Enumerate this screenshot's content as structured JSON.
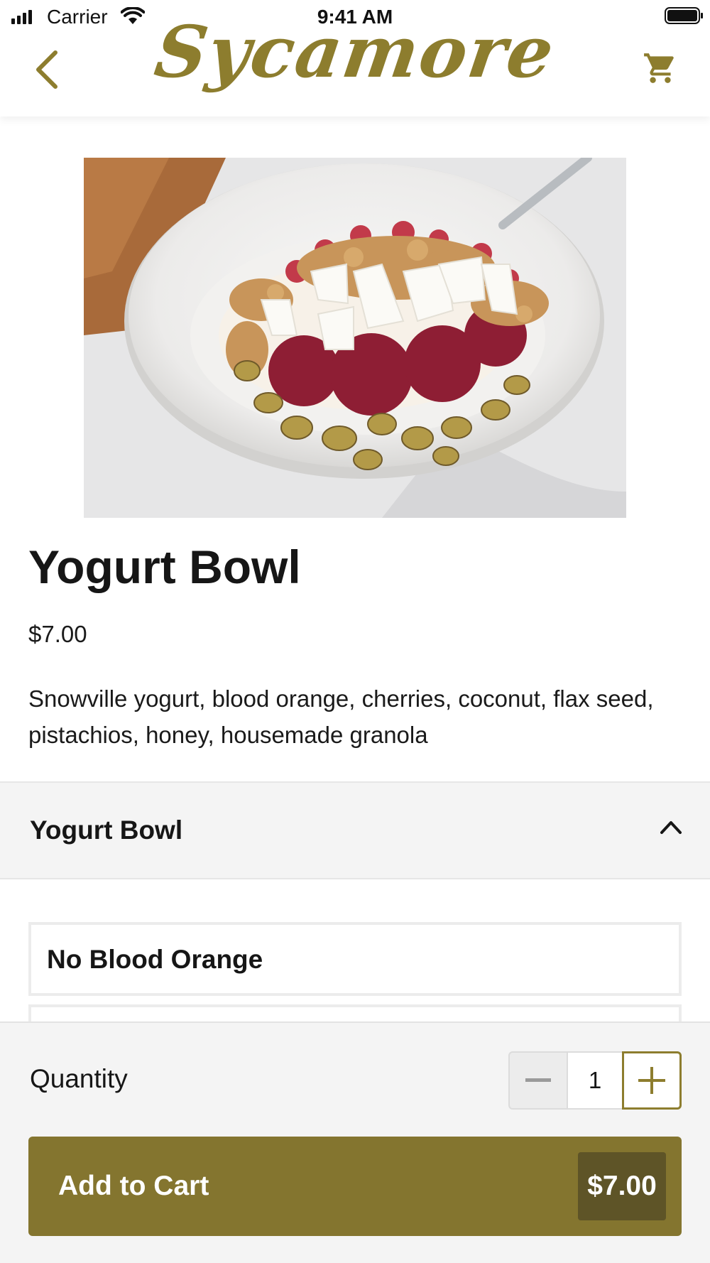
{
  "status_bar": {
    "carrier": "Carrier",
    "time": "9:41 AM",
    "icons": [
      "signal-icon",
      "wifi-icon",
      "battery-icon"
    ]
  },
  "header": {
    "logo_text": "Sycamore",
    "back_icon": "chevron-left-icon",
    "cart_icon": "cart-icon",
    "brand_color": "#8d7d2e"
  },
  "product": {
    "image_description_icon": "yogurt-bowl-photo",
    "title": "Yogurt Bowl",
    "price": "$7.00",
    "description": "Snowville yogurt, blood orange, cherries, coconut, flax seed, pistachios, honey, housemade granola"
  },
  "modifiers": {
    "section_title": "Yogurt Bowl",
    "expanded": true,
    "options": [
      {
        "label": "No Blood Orange"
      },
      {
        "label": ""
      }
    ]
  },
  "order": {
    "quantity_label": "Quantity",
    "quantity": "1",
    "minus_icon": "minus-icon",
    "plus_icon": "plus-icon",
    "add_label": "Add to Cart",
    "total": "$7.00",
    "button_color": "#84752f"
  }
}
